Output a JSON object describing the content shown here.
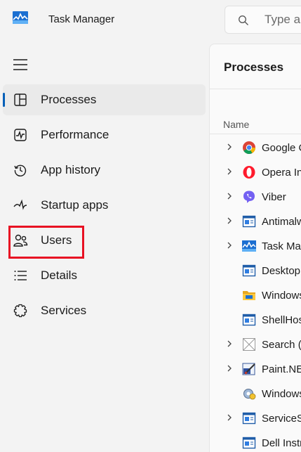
{
  "titlebar": {
    "title": "Task Manager"
  },
  "search": {
    "placeholder": "Type a"
  },
  "nav": {
    "items": [
      {
        "label": "Processes",
        "icon": "processes-icon",
        "selected": true
      },
      {
        "label": "Performance",
        "icon": "performance-icon"
      },
      {
        "label": "App history",
        "icon": "app-history-icon"
      },
      {
        "label": "Startup apps",
        "icon": "startup-apps-icon"
      },
      {
        "label": "Users",
        "icon": "users-icon",
        "highlighted": true
      },
      {
        "label": "Details",
        "icon": "details-icon"
      },
      {
        "label": "Services",
        "icon": "services-icon"
      }
    ]
  },
  "main": {
    "title": "Processes",
    "column_name": "Name",
    "processes": [
      {
        "name": "Google C",
        "icon": "chrome-icon",
        "expandable": true
      },
      {
        "name": "Opera In",
        "icon": "opera-icon",
        "expandable": true
      },
      {
        "name": "Viber",
        "icon": "viber-icon",
        "expandable": true
      },
      {
        "name": "Antimalw",
        "icon": "window-app-icon",
        "expandable": true
      },
      {
        "name": "Task Man",
        "icon": "task-manager-icon",
        "expandable": true
      },
      {
        "name": "Desktop",
        "icon": "window-app-icon",
        "expandable": false
      },
      {
        "name": "Windows",
        "icon": "folder-icon",
        "expandable": false
      },
      {
        "name": "ShellHos",
        "icon": "window-app-icon",
        "expandable": false
      },
      {
        "name": "Search (",
        "icon": "search-app-icon",
        "expandable": true
      },
      {
        "name": "Paint.NE",
        "icon": "paint-net-icon",
        "expandable": true
      },
      {
        "name": "Windows",
        "icon": "gear-app-icon",
        "expandable": false
      },
      {
        "name": "ServiceS",
        "icon": "window-app-icon",
        "expandable": true
      },
      {
        "name": "Dell Instr",
        "icon": "window-app-icon",
        "expandable": false
      }
    ]
  },
  "colors": {
    "accent": "#005fb8",
    "highlight": "#e81123",
    "background": "#f3f3f3"
  }
}
